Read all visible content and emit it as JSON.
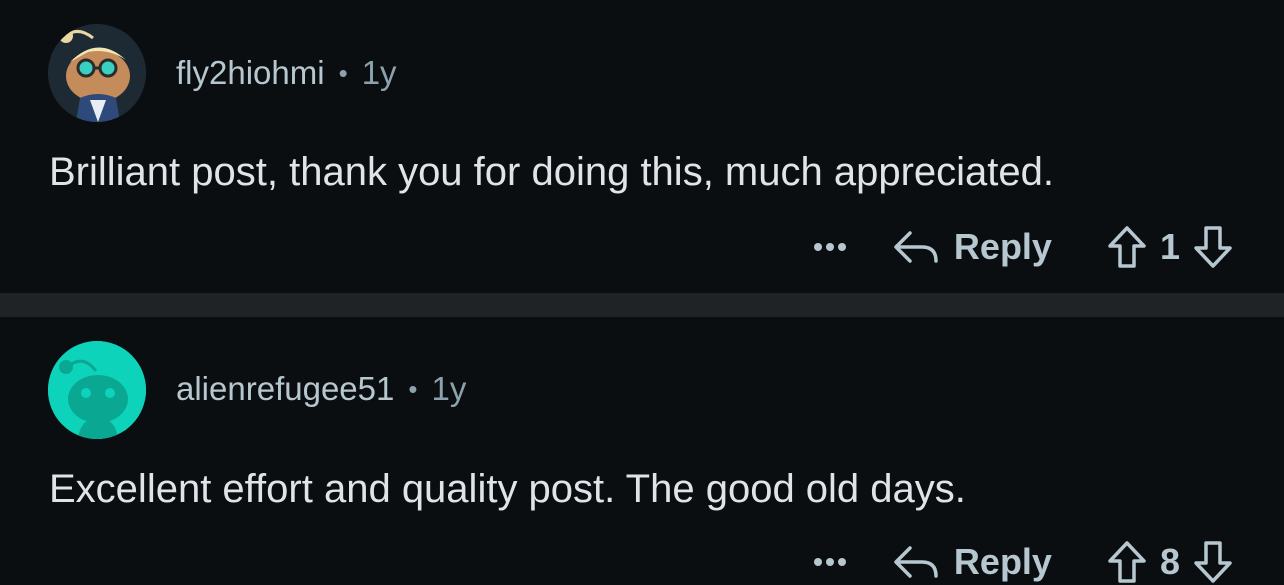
{
  "comments": [
    {
      "username": "fly2hiohmi",
      "separator": "•",
      "age": "1y",
      "text": "Brilliant post, thank you for doing this, much appreciated.",
      "reply_label": "Reply",
      "score": "1"
    },
    {
      "username": "alienrefugee51",
      "separator": "•",
      "age": "1y",
      "text": "Excellent effort and quality post. The good old days.",
      "reply_label": "Reply",
      "score": "8"
    }
  ],
  "colors": {
    "background": "#0b0e11",
    "divider": "#1f2326",
    "avatar2_bg": "#0dd3bb",
    "text": "#dfe4e8",
    "muted": "#8ba2ad"
  }
}
